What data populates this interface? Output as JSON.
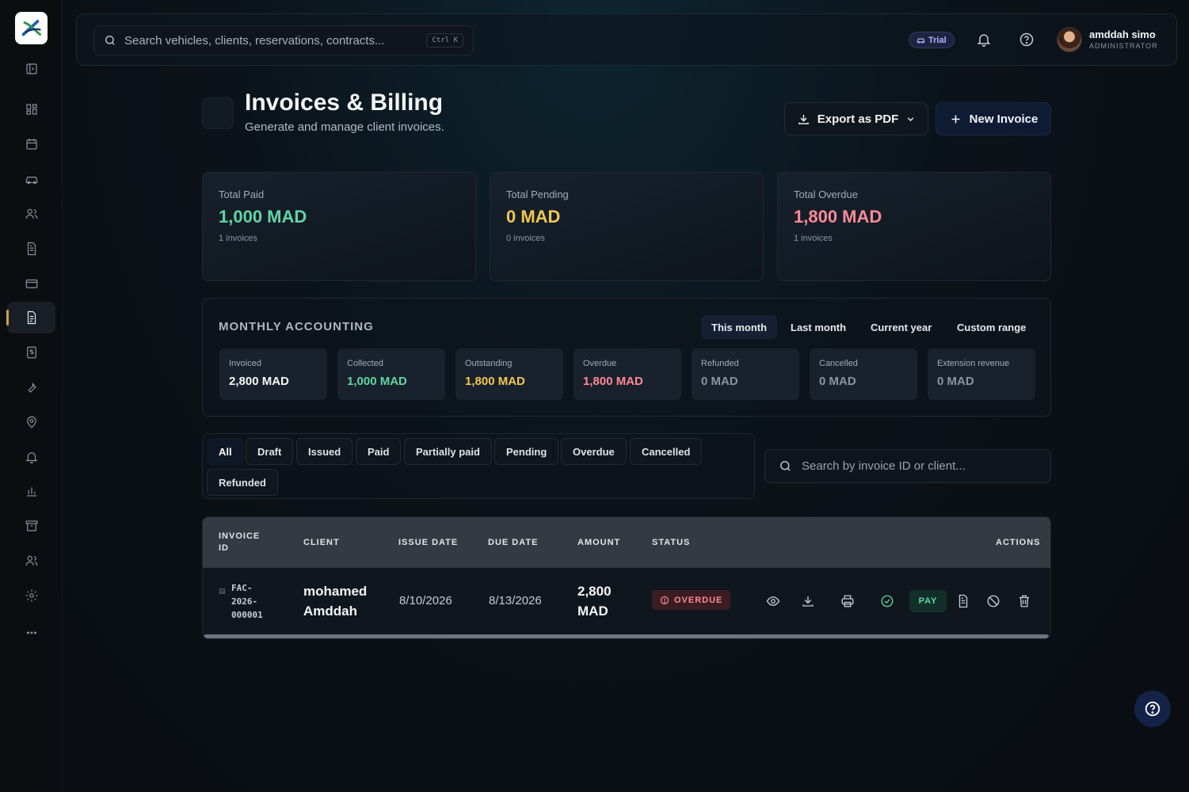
{
  "colors": {
    "paid": "#5fd6a6",
    "pending": "#f3c74f",
    "overdue": "#ff8a96",
    "muted": "#8b93a1",
    "accent": "#c9a24b"
  },
  "sidebar": {
    "items": [
      {
        "icon": "panel-toggle-icon"
      },
      {
        "icon": "dashboard-grid-icon"
      },
      {
        "icon": "calendar-icon"
      },
      {
        "icon": "car-icon"
      },
      {
        "icon": "users-icon"
      },
      {
        "icon": "contract-document-icon"
      },
      {
        "icon": "credit-card-icon"
      },
      {
        "icon": "invoice-icon",
        "active": true
      },
      {
        "icon": "dollar-receipt-icon"
      },
      {
        "icon": "wrench-icon"
      },
      {
        "icon": "map-pin-icon"
      },
      {
        "icon": "bell-icon"
      },
      {
        "icon": "bar-chart-icon"
      },
      {
        "icon": "archive-icon"
      },
      {
        "icon": "team-icon"
      },
      {
        "icon": "settings-gear-icon"
      },
      {
        "icon": "more-dots-icon"
      }
    ]
  },
  "topbar": {
    "search_placeholder": "Search vehicles, clients, reservations, contracts...",
    "shortcut": "Ctrl K",
    "trial_label": "Trial",
    "user_name": "amddah simo",
    "user_role": "ADMINISTRATOR"
  },
  "header": {
    "title": "Invoices & Billing",
    "subtitle": "Generate and manage client invoices.",
    "export_label": "Export as PDF",
    "new_label": "New Invoice"
  },
  "stats": [
    {
      "label": "Total Paid",
      "value": "1,000 MAD",
      "sub": "1 invoices",
      "color": "#5fd6a6"
    },
    {
      "label": "Total Pending",
      "value": "0 MAD",
      "sub": "0 invoices",
      "color": "#f3c74f"
    },
    {
      "label": "Total Overdue",
      "value": "1,800 MAD",
      "sub": "1 invoices",
      "color": "#ff8a96"
    }
  ],
  "accounting": {
    "title": "MONTHLY ACCOUNTING",
    "ranges": [
      "This month",
      "Last month",
      "Current year",
      "Custom range"
    ],
    "active_range": "This month",
    "items": [
      {
        "label": "Invoiced",
        "value": "2,800 MAD",
        "color": "#f5f6f8"
      },
      {
        "label": "Collected",
        "value": "1,000 MAD",
        "color": "#5fd6a6"
      },
      {
        "label": "Outstanding",
        "value": "1,800 MAD",
        "color": "#f3c74f"
      },
      {
        "label": "Overdue",
        "value": "1,800 MAD",
        "color": "#ff8a96"
      },
      {
        "label": "Refunded",
        "value": "0 MAD",
        "color": "#8b93a1"
      },
      {
        "label": "Cancelled",
        "value": "0 MAD",
        "color": "#8b93a1"
      },
      {
        "label": "Extension revenue",
        "value": "0 MAD",
        "color": "#8b93a1"
      }
    ]
  },
  "filters": {
    "chips": [
      "All",
      "Draft",
      "Issued",
      "Paid",
      "Partially paid",
      "Pending",
      "Overdue",
      "Cancelled",
      "Refunded"
    ],
    "active": "All",
    "search_placeholder": "Search by invoice ID or client..."
  },
  "table": {
    "columns": {
      "invoice_id": "INVOICE\nID",
      "client": "CLIENT",
      "issue_date": "ISSUE DATE",
      "due_date": "DUE DATE",
      "amount": "AMOUNT",
      "status": "STATUS",
      "actions": "ACTIONS"
    },
    "rows": [
      {
        "invoice_id": "FAC-\n2026-\n000001",
        "client": "mohamed\nAmddah",
        "issue_date": "8/10/2026",
        "due_date": "8/13/2026",
        "amount": "2,800\nMAD",
        "status": "OVERDUE",
        "pay_label": "PAY"
      }
    ]
  }
}
